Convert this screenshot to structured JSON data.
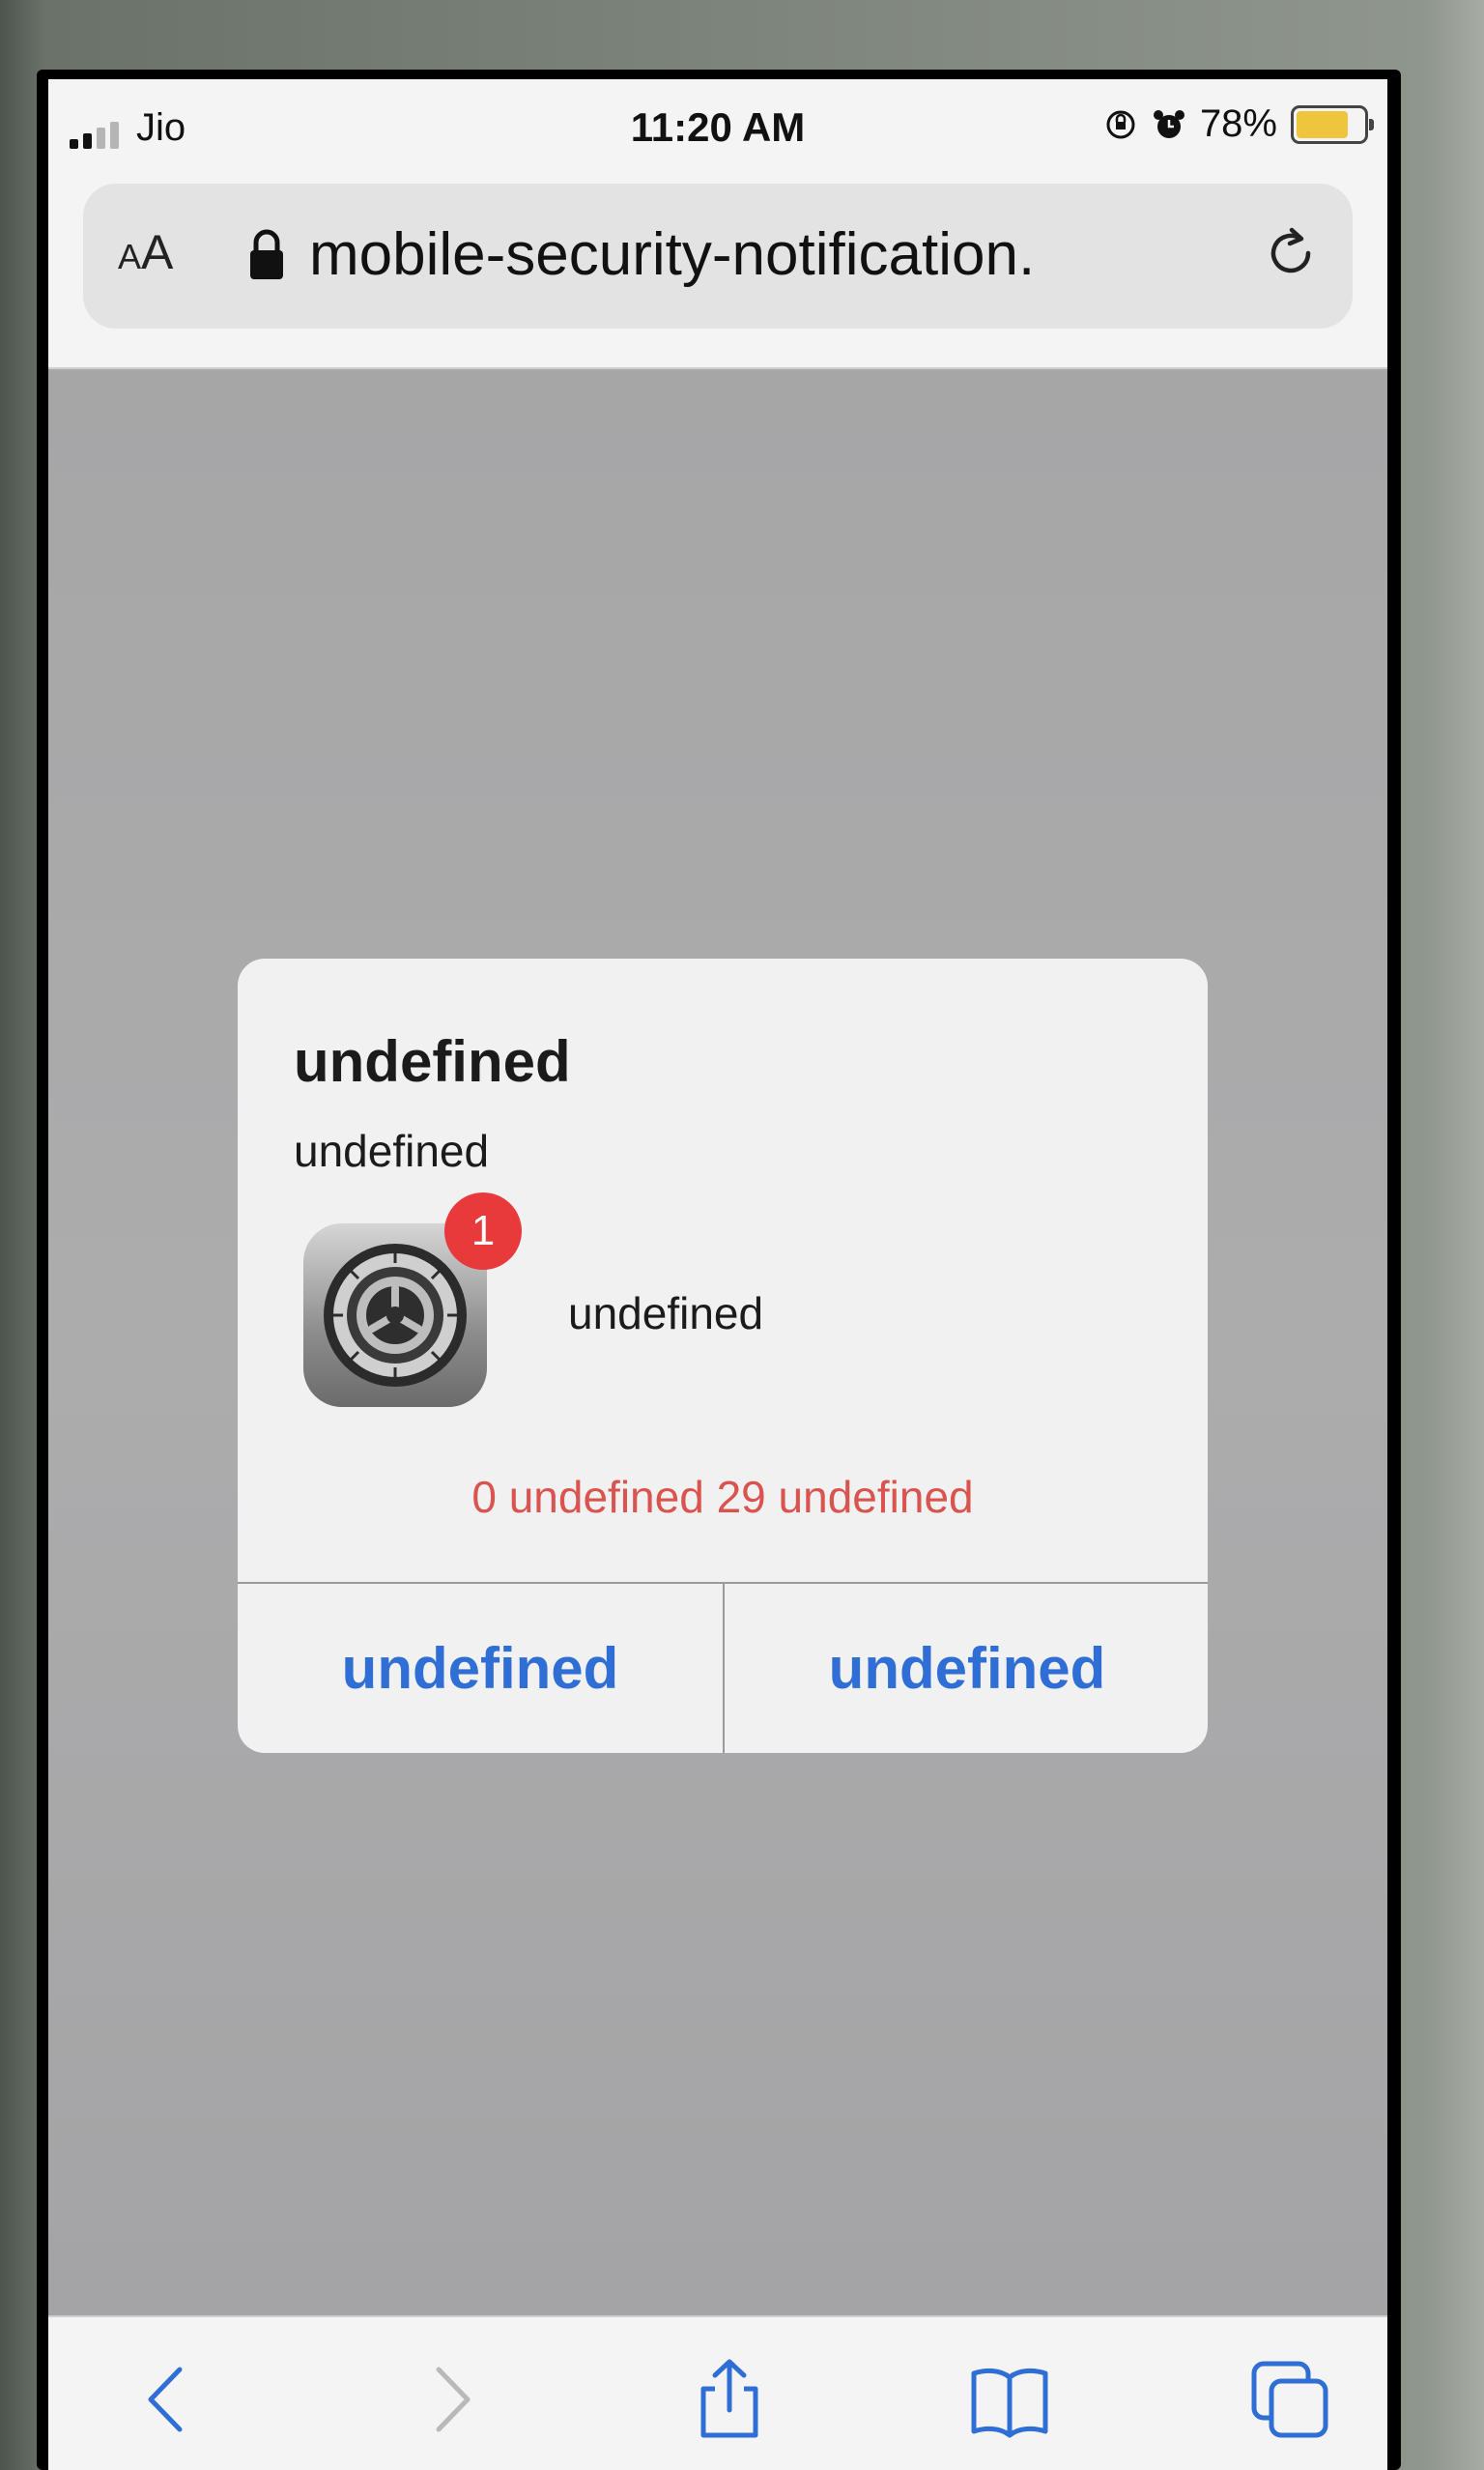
{
  "status_bar": {
    "carrier": "Jio",
    "time": "11:20 AM",
    "battery_percent": "78%",
    "battery_level": 0.78,
    "signal_bars_active": 2,
    "signal_bars_total": 4,
    "icons": [
      "orientation-lock-icon",
      "alarm-icon"
    ]
  },
  "browser": {
    "text_size_label_small": "A",
    "text_size_label_large": "A",
    "url": "mobile-security-notification.",
    "icons": [
      "lock-icon",
      "reload-icon"
    ]
  },
  "dialog": {
    "title": "undefined",
    "subtitle": "undefined",
    "app_icon": "settings-gear-icon",
    "badge_count": "1",
    "app_label": "undefined",
    "countdown": "0 undefined 29 undefined",
    "left_button": "undefined",
    "right_button": "undefined",
    "colors": {
      "button_text": "#2f6ed4",
      "countdown": "#d9534f",
      "badge": "#e8393b"
    }
  },
  "toolbar": {
    "buttons": [
      "back-icon",
      "forward-icon",
      "share-icon",
      "bookmarks-icon",
      "tabs-icon"
    ],
    "accent": "#2f6ed4"
  }
}
